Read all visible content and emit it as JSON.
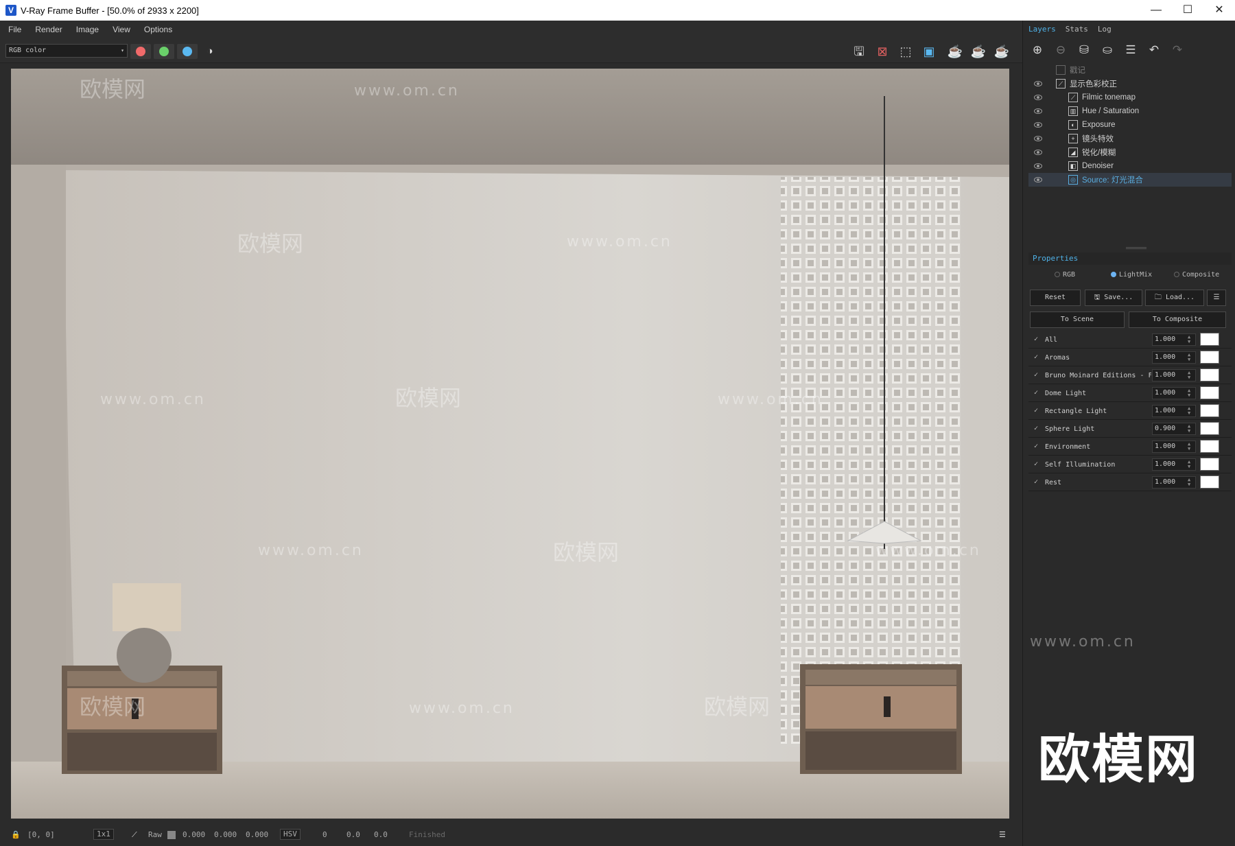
{
  "window": {
    "title": "V-Ray Frame Buffer - [50.0% of 2933 x 2200]",
    "app_icon_glyph": "V",
    "controls": {
      "minimize": "—",
      "maximize": "☐",
      "close": "✕"
    }
  },
  "menu": {
    "items": [
      "File",
      "Render",
      "Image",
      "View",
      "Options"
    ]
  },
  "toolbar": {
    "channel": "RGB color",
    "channel_caret": "▾",
    "color_dots": [
      {
        "name": "red-channel",
        "color": "#f06a6a"
      },
      {
        "name": "green-channel",
        "color": "#6ad06a"
      },
      {
        "name": "blue-channel",
        "color": "#5ab8f0"
      }
    ],
    "icons": [
      "save-image-icon",
      "clear-image-icon",
      "region-render-icon",
      "track-mouse-icon",
      "render-icon",
      "interactive-render-icon",
      "stop-render-icon"
    ]
  },
  "right_panel": {
    "tabs": [
      {
        "label": "Layers",
        "active": true
      },
      {
        "label": "Stats",
        "active": false
      },
      {
        "label": "Log",
        "active": false
      }
    ],
    "layer_tool_icons": [
      "add-layer-icon",
      "remove-layer-icon",
      "load-layers-icon",
      "save-layers-icon",
      "layer-list-icon",
      "undo-icon",
      "redo-icon"
    ],
    "layers": [
      {
        "name": "戳记",
        "indent": 1,
        "dim": true,
        "selected": false
      },
      {
        "name": "显示色彩校正",
        "indent": 1,
        "dim": false,
        "selected": false
      },
      {
        "name": "Filmic tonemap",
        "indent": 2,
        "dim": false,
        "selected": false
      },
      {
        "name": "Hue / Saturation",
        "indent": 2,
        "dim": false,
        "selected": false
      },
      {
        "name": "Exposure",
        "indent": 2,
        "dim": false,
        "selected": false
      },
      {
        "name": "镜头特效",
        "indent": 2,
        "dim": false,
        "selected": false
      },
      {
        "name": "锐化/模糊",
        "indent": 2,
        "dim": false,
        "selected": false
      },
      {
        "name": "Denoiser",
        "indent": 2,
        "dim": false,
        "selected": false
      },
      {
        "name": "Source: 灯光混合",
        "indent": 2,
        "dim": false,
        "selected": true
      }
    ],
    "properties": {
      "title": "Properties",
      "modes": [
        {
          "label": "RGB",
          "on": false
        },
        {
          "label": "LightMix",
          "on": true
        },
        {
          "label": "Composite",
          "on": false
        }
      ],
      "buttons": {
        "reset": "Reset",
        "save": "Save...",
        "load": "Load...",
        "to_scene": "To Scene",
        "to_composite": "To Composite"
      },
      "lights": [
        {
          "name": "All",
          "value": "1.000",
          "checked": "✓"
        },
        {
          "name": "Aromas",
          "value": "1.000",
          "checked": "✓"
        },
        {
          "name": "Bruno Moinard Editions - F",
          "value": "1.000",
          "checked": "✓"
        },
        {
          "name": "Dome Light",
          "value": "1.000",
          "checked": "✓"
        },
        {
          "name": "Rectangle Light",
          "value": "1.000",
          "checked": "✓"
        },
        {
          "name": "Sphere Light",
          "value": "0.900",
          "checked": "✓"
        },
        {
          "name": "Environment",
          "value": "1.000",
          "checked": "✓"
        },
        {
          "name": "Self Illumination",
          "value": "1.000",
          "checked": "✓"
        },
        {
          "name": "Rest",
          "value": "1.000",
          "checked": "✓"
        }
      ]
    }
  },
  "statusbar": {
    "coords": "[0, 0]",
    "zoom": "1x1",
    "raw_label": "Raw",
    "rgb": [
      "0.000",
      "0.000",
      "0.000"
    ],
    "color_mode": "HSV",
    "hsv": [
      "0",
      "0.0",
      "0.0"
    ],
    "status": "Finished"
  },
  "watermarks": {
    "url": "www.om.cn",
    "brand": "欧模网"
  },
  "brand_logo": "欧模网"
}
